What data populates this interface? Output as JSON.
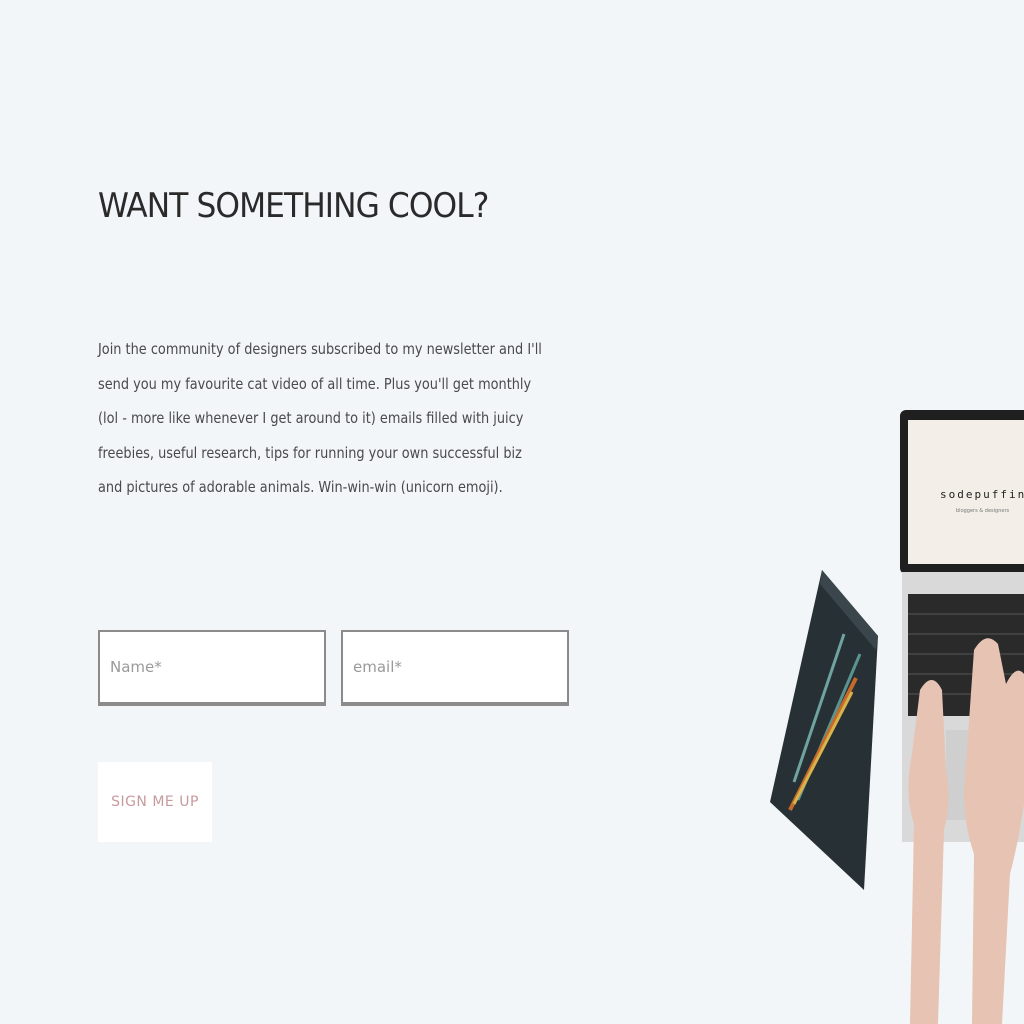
{
  "newsletter": {
    "heading": "WANT SOMETHING COOL?",
    "description": "Join the community of designers subscribed to my newsletter and I'll send you my favourite cat video of all time.  Plus you'll get monthly (lol - more like whenever I get around to it) emails filled with juicy freebies, useful research, tips for running your own successful biz and pictures of adorable animals. Win-win-win (unicorn emoji).",
    "name_placeholder": "Name*",
    "email_placeholder": "email*",
    "signup_label": "SIGN ME UP"
  },
  "photo": {
    "screen_brand": "sodepuffin",
    "screen_tagline": "bloggers & designers"
  },
  "colors": {
    "background": "#f2f6f9",
    "button_text": "#c79a9e",
    "field_border": "#8b8b8b"
  }
}
